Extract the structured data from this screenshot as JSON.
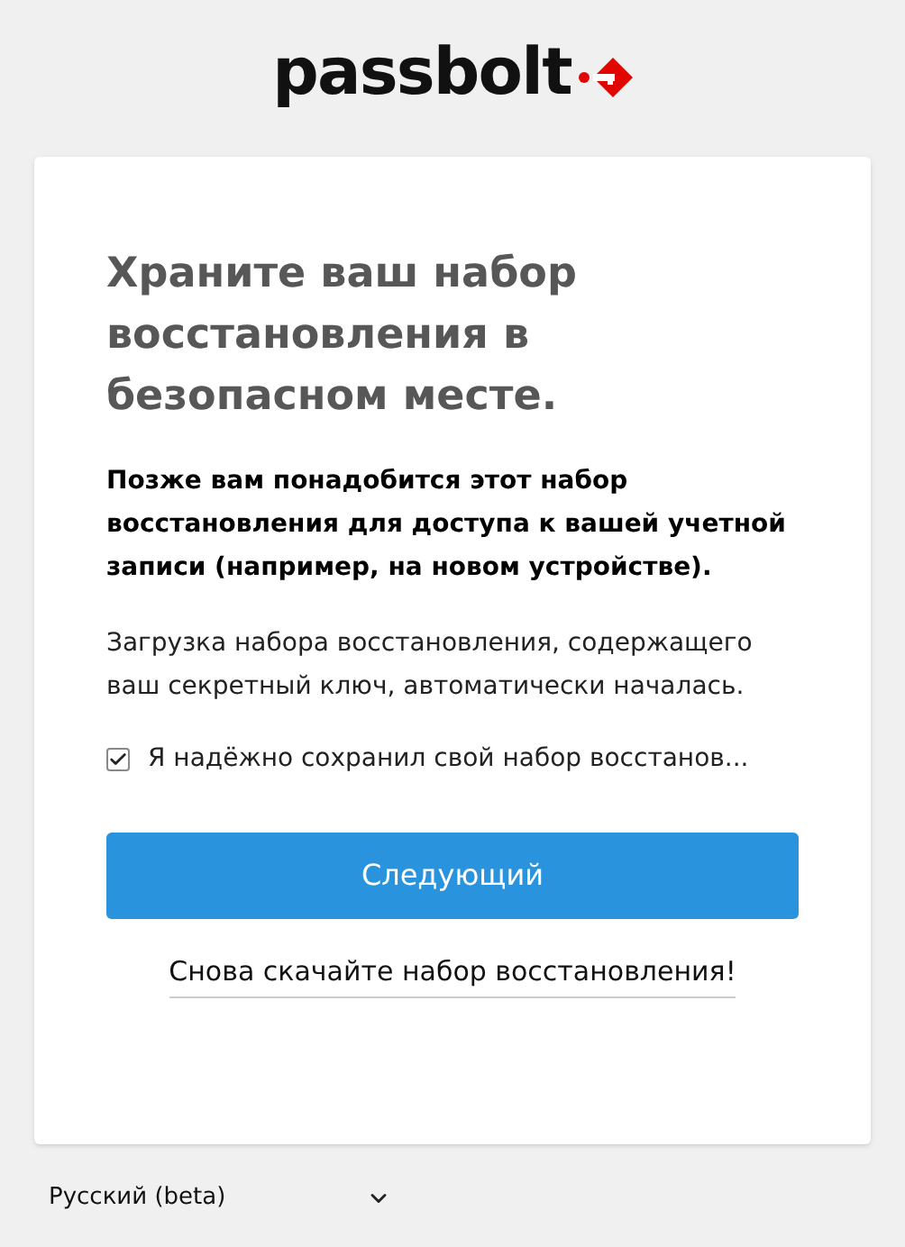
{
  "logo": {
    "text": "passbolt"
  },
  "card": {
    "title": "Храните ваш набор восстановления в безопасном месте.",
    "notice": "Позже вам понадобится этот набор восстановления для доступа к вашей учетной записи (например, на новом устройстве).",
    "info": "Загрузка набора восстановления, содержащего ваш секретный ключ, автоматически началась.",
    "checkbox": {
      "label": "Я надёжно сохранил свой набор восстанов...",
      "checked": true
    },
    "button": "Следующий",
    "link": "Снова скачайте набор восстановления!"
  },
  "language": {
    "value": "Русский (beta)"
  }
}
